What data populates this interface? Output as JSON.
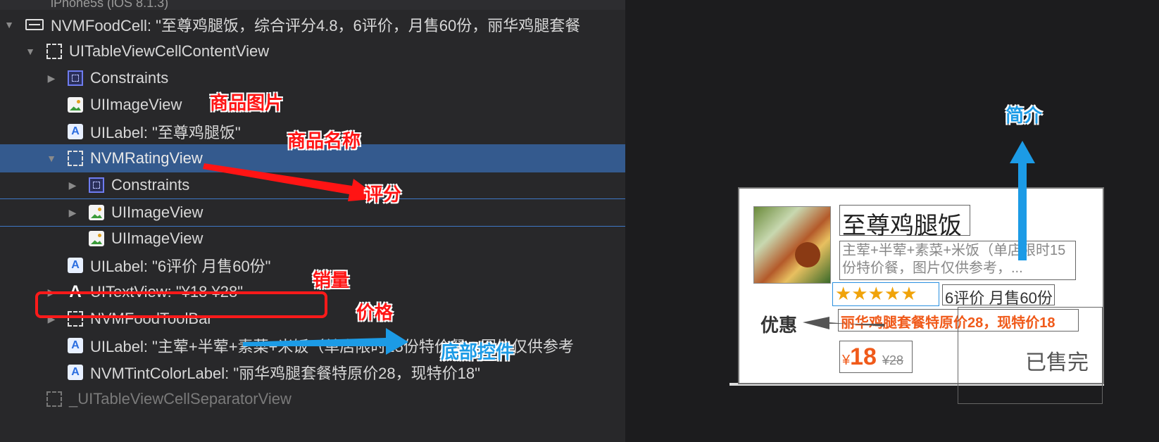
{
  "tree": {
    "device": "iPhone5s (iOS 8.1.3)",
    "rows": [
      {
        "label": "NVMFoodCell: \"至尊鸡腿饭，综合评分4.8，6评价，月售60份，丽华鸡腿套餐"
      },
      {
        "label": "UITableViewCellContentView"
      },
      {
        "label": "Constraints"
      },
      {
        "label": "UIImageView"
      },
      {
        "label": "UILabel: \"至尊鸡腿饭\""
      },
      {
        "label": "NVMRatingView"
      },
      {
        "label": "Constraints"
      },
      {
        "label": "UIImageView"
      },
      {
        "label": "UIImageView"
      },
      {
        "label": "UILabel: \"6评价 月售60份\""
      },
      {
        "label": "UITextView: \"¥18 ¥28\""
      },
      {
        "label": "NVMFoodToolBar"
      },
      {
        "label": "UILabel: \"主荤+半荤+素菜+米饭（单店限时15份特价餐，图片仅供参考"
      },
      {
        "label": "NVMTintColorLabel: \"丽华鸡腿套餐特原价28，现特价18\""
      },
      {
        "label": "_UITableViewCellSeparatorView"
      }
    ]
  },
  "annotations": {
    "image": "商品图片",
    "name": "商品名称",
    "rating": "评分",
    "sales": "销量",
    "price": "价格",
    "toolbar": "底部控件",
    "intro": "简介",
    "promo": "优惠"
  },
  "preview": {
    "title": "至尊鸡腿饭",
    "intro": "主荤+半荤+素菜+米饭（单店限时15份特价餐，图片仅供参考，...",
    "stars": "★★★★★",
    "sales": "6评价 月售60份",
    "promo": "丽华鸡腿套餐特原价28，现特价18",
    "price_currency": "¥",
    "price_now": "18",
    "price_old": "¥28",
    "soldout": "已售完"
  },
  "colors": {
    "selection": "#345a8e",
    "annotation_red": "#ff1414",
    "annotation_blue": "#1c9be6",
    "price_orange": "#f05a1a",
    "star": "#f0a30a"
  }
}
